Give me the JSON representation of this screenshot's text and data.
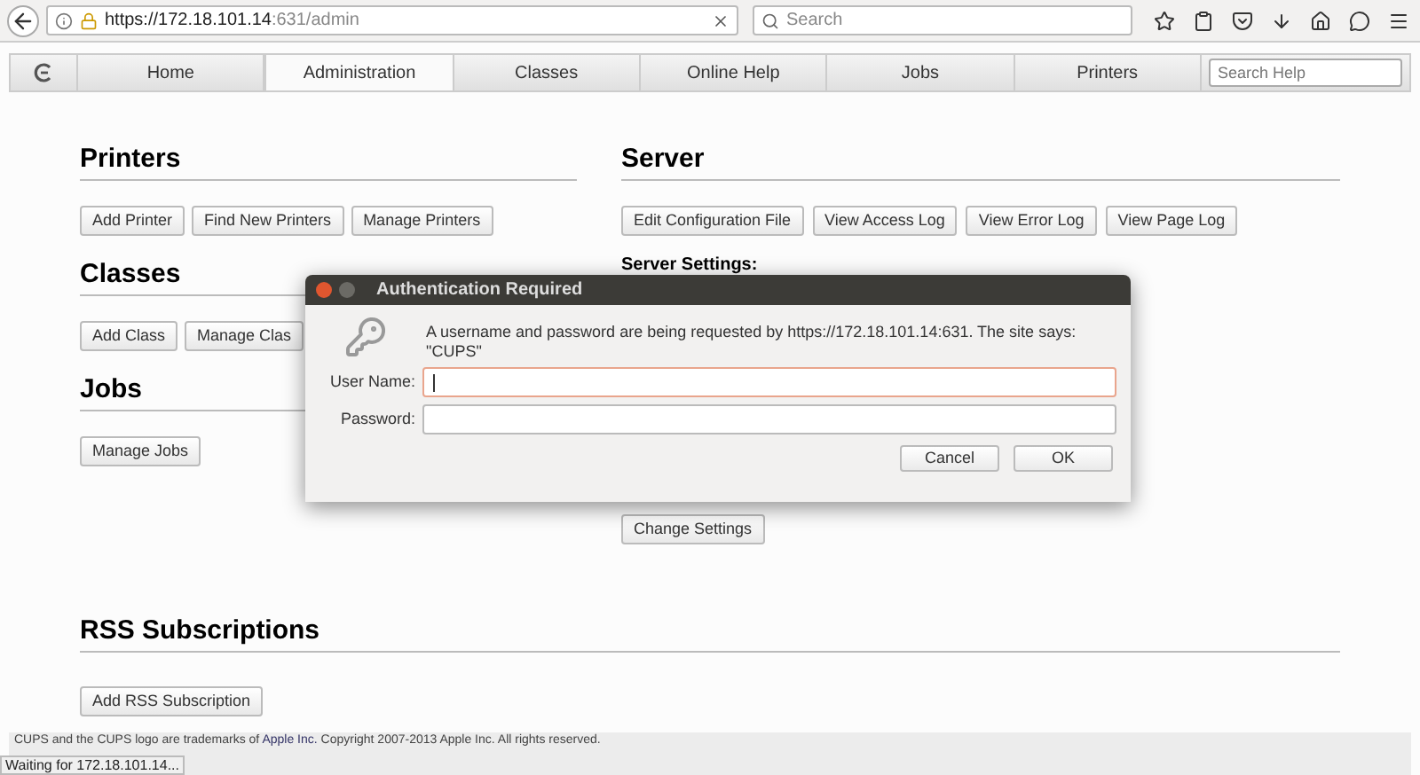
{
  "browser": {
    "url_host": "https://172.18.101.14",
    "url_rest": ":631/admin",
    "search_placeholder": "Search"
  },
  "nav": {
    "tabs": [
      {
        "label": "Home",
        "selected": false
      },
      {
        "label": "Administration",
        "selected": true
      },
      {
        "label": "Classes",
        "selected": false
      },
      {
        "label": "Online Help",
        "selected": false
      },
      {
        "label": "Jobs",
        "selected": false
      },
      {
        "label": "Printers",
        "selected": false
      }
    ],
    "search_placeholder": "Search Help"
  },
  "left_sections": [
    {
      "title": "Printers",
      "buttons": [
        "Add Printer",
        "Find New Printers",
        "Manage Printers"
      ]
    },
    {
      "title": "Classes",
      "buttons": [
        "Add Class",
        "Manage Clas"
      ]
    },
    {
      "title": "Jobs",
      "buttons": [
        "Manage Jobs"
      ]
    }
  ],
  "server": {
    "title": "Server",
    "buttons": [
      "Edit Configuration File",
      "View Access Log",
      "View Error Log",
      "View Page Log"
    ],
    "settings_label": "Server Settings:",
    "change_button": "Change Settings"
  },
  "rss": {
    "title": "RSS Subscriptions",
    "button": "Add RSS Subscription"
  },
  "footer": {
    "before": "CUPS and the CUPS logo are trademarks of ",
    "link": "Apple Inc.",
    "after": " Copyright 2007-2013 Apple Inc. All rights reserved."
  },
  "status": "Waiting for 172.18.101.14...",
  "dialog": {
    "title": "Authentication Required",
    "message": "A username and password are being requested by https://172.18.101.14:631. The site says: \"CUPS\"",
    "fields": [
      {
        "label": "User Name:",
        "focused": true
      },
      {
        "label": "Password:",
        "focused": false
      }
    ],
    "buttons": [
      "Cancel",
      "OK"
    ]
  }
}
